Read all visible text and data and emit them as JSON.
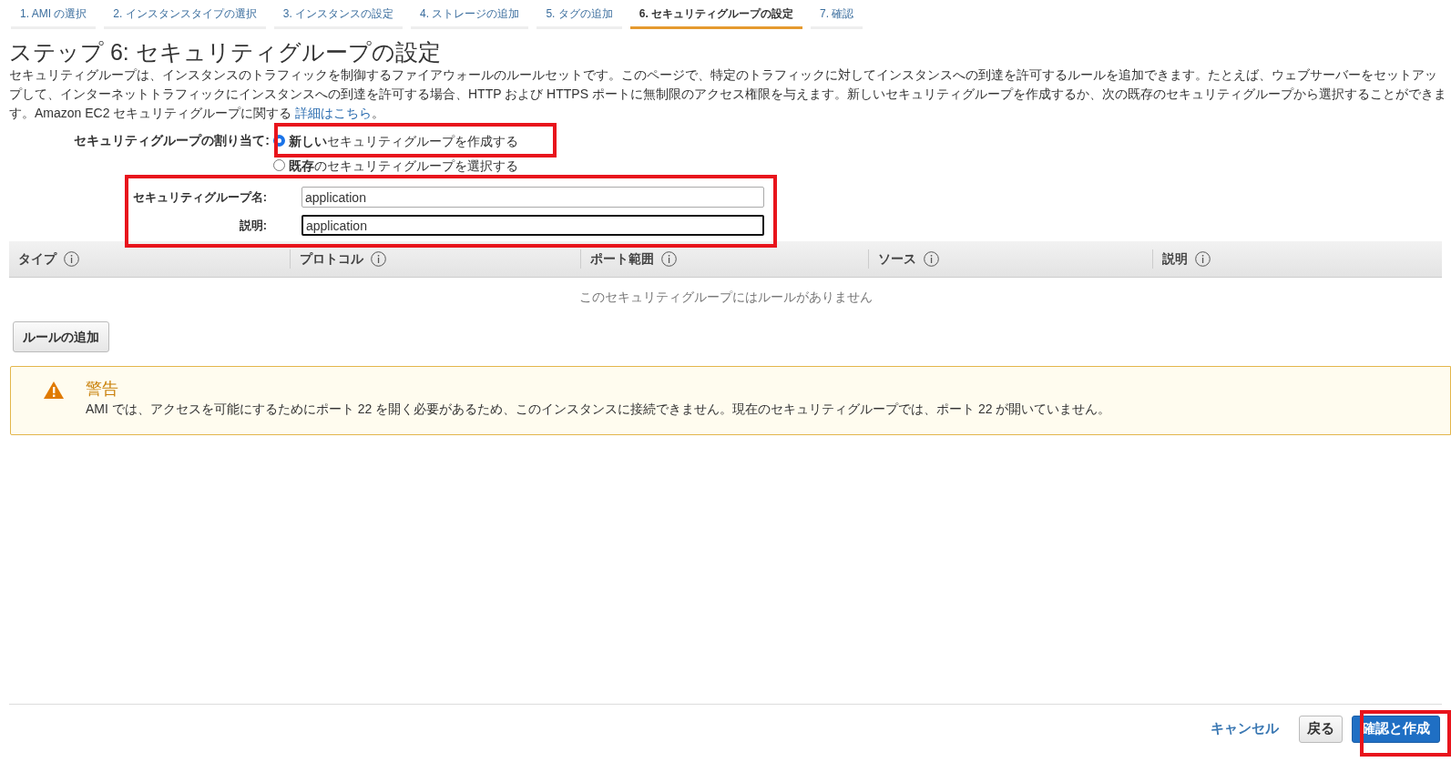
{
  "tabs": [
    {
      "label": "1. AMI の選択",
      "selected": false
    },
    {
      "label": "2. インスタンスタイプの選択",
      "selected": false
    },
    {
      "label": "3. インスタンスの設定",
      "selected": false
    },
    {
      "label": "4. ストレージの追加",
      "selected": false
    },
    {
      "label": "5. タグの追加",
      "selected": false
    },
    {
      "label": "6. セキュリティグループの設定",
      "selected": true
    },
    {
      "label": "7. 確認",
      "selected": false
    }
  ],
  "heading": "ステップ 6: セキュリティグループの設定",
  "intro": {
    "text": "セキュリティグループは、インスタンスのトラフィックを制御するファイアウォールのルールセットです。このページで、特定のトラフィックに対してインスタンスへの到達を許可するルールを追加できます。たとえば、ウェブサーバーをセットアップして、インターネットトラフィックにインスタンスへの到達を許可する場合、HTTP および HTTPS ポートに無制限のアクセス権限を与えます。新しいセキュリティグループを作成するか、次の既存のセキュリティグループから選択することができます。Amazon EC2 セキュリティグループに関する",
    "link": "詳細はこちら",
    "suffix": "。"
  },
  "assignment": {
    "label": "セキュリティグループの割り当て:",
    "options": [
      {
        "label": "**新しい**セキュリティグループを作成する",
        "selected": true
      },
      {
        "label": "**既存**のセキュリティグループを選択する",
        "selected": false
      }
    ]
  },
  "fields": [
    {
      "label": "セキュリティグループ名:",
      "value": "application",
      "focused": false
    },
    {
      "label": "説明:",
      "value": "application",
      "focused": true
    }
  ],
  "rules_table": {
    "columns": [
      "タイプ",
      "プロトコル",
      "ポート範囲",
      "ソース",
      "説明"
    ],
    "empty_message": "このセキュリティグループにはルールがありません"
  },
  "add_rule_button": "ルールの追加",
  "warning": {
    "title": "警告",
    "message": "AMI では、アクセスを可能にするためにポート 22 を開く必要があるため、このインスタンスに接続できません。現在のセキュリティグループでは、ポート 22 が開いていません。"
  },
  "footer": {
    "cancel": "キャンセル",
    "back": "戻る",
    "submit": "確認と作成"
  }
}
